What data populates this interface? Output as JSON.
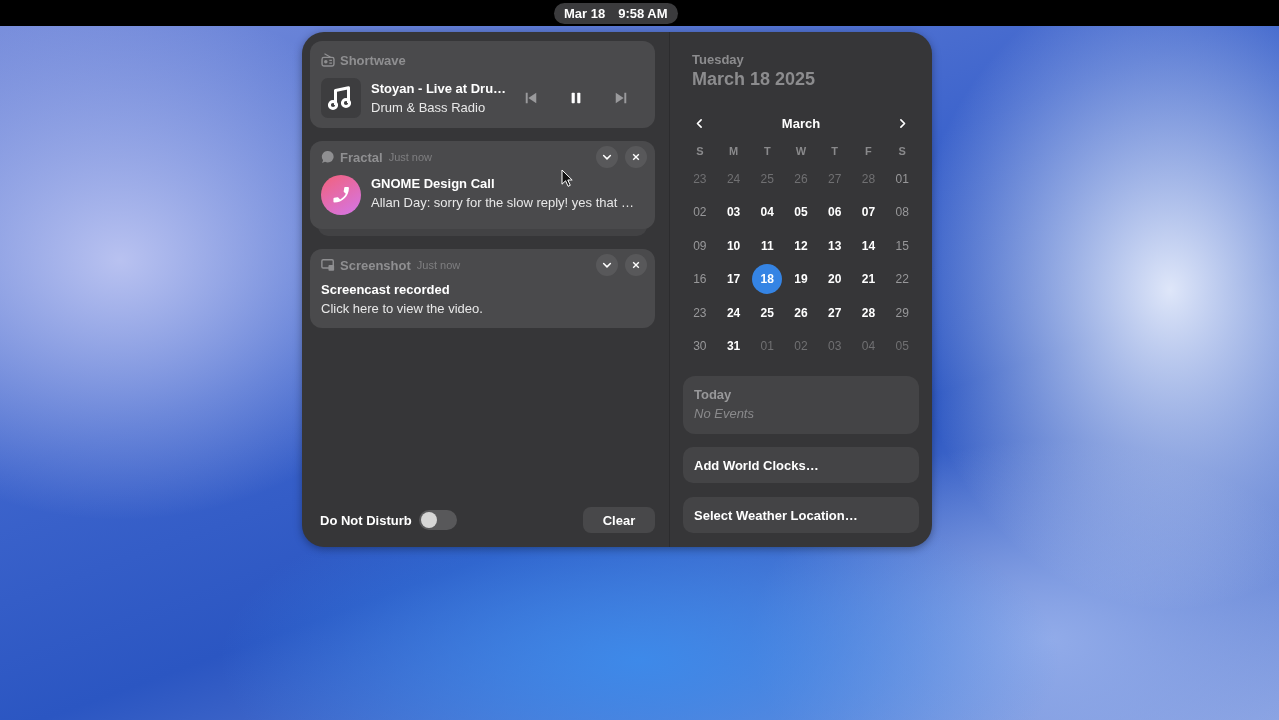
{
  "top_bar": {
    "date": "Mar 18",
    "time": "9:58 AM"
  },
  "notifications": [
    {
      "kind": "media",
      "app": "Shortwave",
      "title": "Stoyan - Live at Dru…",
      "subtitle": "Drum & Bass Radio",
      "controls": [
        {
          "kind": "previous",
          "disabled": true
        },
        {
          "kind": "pause",
          "disabled": false
        },
        {
          "kind": "next",
          "disabled": true
        }
      ]
    },
    {
      "kind": "call",
      "app": "Fractal",
      "time": "Just now",
      "title": "GNOME Design Call",
      "body": "Allan Day: sorry for the slow reply! yes that …",
      "stacked": true
    },
    {
      "kind": "plain",
      "app": "Screenshot",
      "time": "Just now",
      "title": "Screencast recorded",
      "body": "Click here to view the video.",
      "stacked": false
    }
  ],
  "do_not_disturb": {
    "label": "Do Not Disturb",
    "on": false
  },
  "clear_button": "Clear",
  "calendar": {
    "weekday": "Tuesday",
    "date": "March 18 2025",
    "month": "March",
    "weekdays": [
      "S",
      "M",
      "T",
      "W",
      "T",
      "F",
      "S"
    ],
    "weeks": [
      [
        {
          "day": "23",
          "kind": "other",
          "selected": false
        },
        {
          "day": "24",
          "kind": "other",
          "selected": false
        },
        {
          "day": "25",
          "kind": "other",
          "selected": false
        },
        {
          "day": "26",
          "kind": "other",
          "selected": false
        },
        {
          "day": "27",
          "kind": "other",
          "selected": false
        },
        {
          "day": "28",
          "kind": "other",
          "selected": false
        },
        {
          "day": "01",
          "kind": "weekend",
          "selected": false
        }
      ],
      [
        {
          "day": "02",
          "kind": "weekend",
          "selected": false
        },
        {
          "day": "03",
          "kind": "weekday",
          "selected": false
        },
        {
          "day": "04",
          "kind": "weekday",
          "selected": false
        },
        {
          "day": "05",
          "kind": "weekday",
          "selected": false
        },
        {
          "day": "06",
          "kind": "weekday",
          "selected": false
        },
        {
          "day": "07",
          "kind": "weekday",
          "selected": false
        },
        {
          "day": "08",
          "kind": "weekend",
          "selected": false
        }
      ],
      [
        {
          "day": "09",
          "kind": "weekend",
          "selected": false
        },
        {
          "day": "10",
          "kind": "weekday",
          "selected": false
        },
        {
          "day": "11",
          "kind": "weekday",
          "selected": false
        },
        {
          "day": "12",
          "kind": "weekday",
          "selected": false
        },
        {
          "day": "13",
          "kind": "weekday",
          "selected": false
        },
        {
          "day": "14",
          "kind": "weekday",
          "selected": false
        },
        {
          "day": "15",
          "kind": "weekend",
          "selected": false
        }
      ],
      [
        {
          "day": "16",
          "kind": "weekend",
          "selected": false
        },
        {
          "day": "17",
          "kind": "weekday",
          "selected": false
        },
        {
          "day": "18",
          "kind": "weekday",
          "selected": true
        },
        {
          "day": "19",
          "kind": "weekday",
          "selected": false
        },
        {
          "day": "20",
          "kind": "weekday",
          "selected": false
        },
        {
          "day": "21",
          "kind": "weekday",
          "selected": false
        },
        {
          "day": "22",
          "kind": "weekend",
          "selected": false
        }
      ],
      [
        {
          "day": "23",
          "kind": "weekend",
          "selected": false
        },
        {
          "day": "24",
          "kind": "weekday",
          "selected": false
        },
        {
          "day": "25",
          "kind": "weekday",
          "selected": false
        },
        {
          "day": "26",
          "kind": "weekday",
          "selected": false
        },
        {
          "day": "27",
          "kind": "weekday",
          "selected": false
        },
        {
          "day": "28",
          "kind": "weekday",
          "selected": false
        },
        {
          "day": "29",
          "kind": "weekend",
          "selected": false
        }
      ],
      [
        {
          "day": "30",
          "kind": "weekend",
          "selected": false
        },
        {
          "day": "31",
          "kind": "weekday",
          "selected": false
        },
        {
          "day": "01",
          "kind": "other",
          "selected": false
        },
        {
          "day": "02",
          "kind": "other",
          "selected": false
        },
        {
          "day": "03",
          "kind": "other",
          "selected": false
        },
        {
          "day": "04",
          "kind": "other",
          "selected": false
        },
        {
          "day": "05",
          "kind": "other",
          "selected": false
        }
      ]
    ]
  },
  "events": {
    "title": "Today",
    "empty_text": "No Events"
  },
  "actions": [
    "Add World Clocks…",
    "Select Weather Location…"
  ]
}
